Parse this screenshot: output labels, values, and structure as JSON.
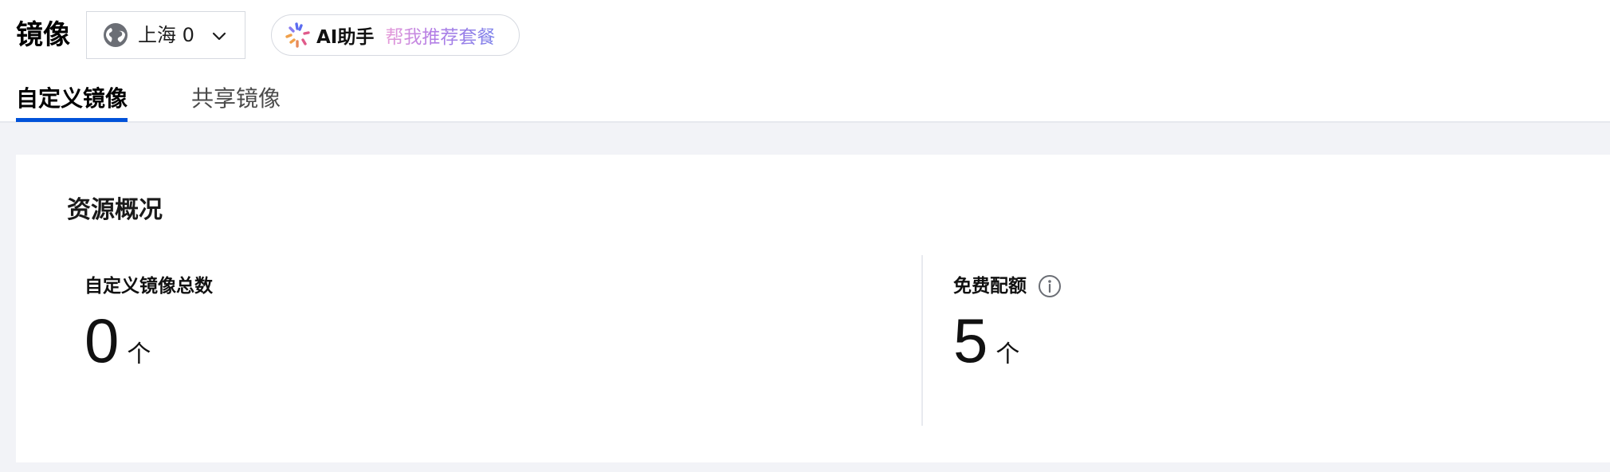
{
  "header": {
    "title": "镜像",
    "region": {
      "label": "上海 0",
      "icon": "globe-icon"
    },
    "ai_assistant": {
      "label": "AI助手",
      "hint": "帮我推荐套餐",
      "icon": "ai-assistant-icon"
    }
  },
  "tabs": [
    {
      "label": "自定义镜像",
      "active": true
    },
    {
      "label": "共享镜像",
      "active": false
    }
  ],
  "overview": {
    "title": "资源概况",
    "stats": [
      {
        "label": "自定义镜像总数",
        "value": "0",
        "unit": "个"
      },
      {
        "label": "免费配额",
        "value": "5",
        "unit": "个",
        "icon": "info-icon"
      }
    ]
  },
  "colors": {
    "accent": "#0052d9",
    "page_background": "#f2f3f7",
    "card_background": "#ffffff"
  }
}
